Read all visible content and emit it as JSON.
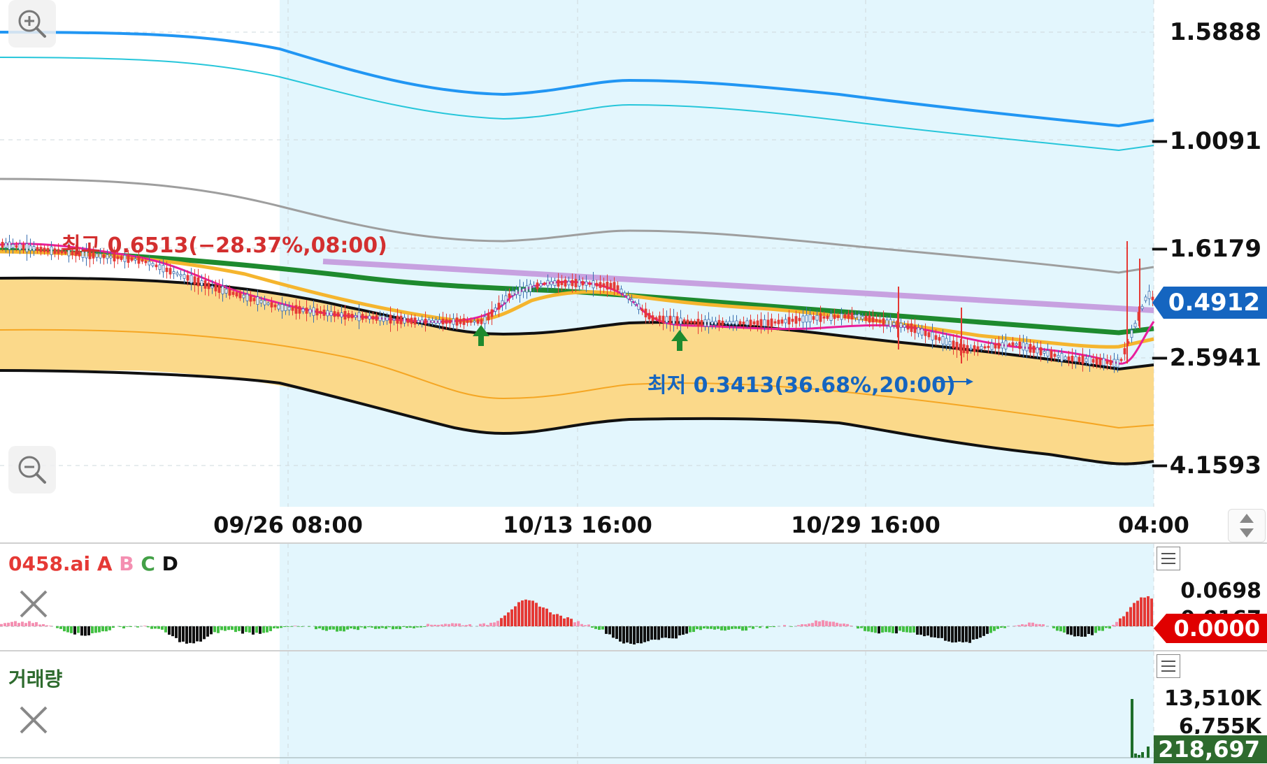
{
  "main_chart": {
    "price_labels": [
      "1.5888",
      "−1.0091",
      "−1.6179",
      "−2.5941",
      "−4.1593"
    ],
    "current_price": "0.4912",
    "current_price_color": "#1565c0",
    "high_annotation": "최고 0.6513(−28.37%,08:00)",
    "low_annotation": "최저 0.3413(36.68%,20:00)",
    "high_color": "#d32f2f",
    "low_color": "#1565c0",
    "zoom_in_icon": "zoom-in-icon",
    "zoom_out_icon": "zoom-out-icon"
  },
  "time_axis": {
    "labels": [
      "09/26 08:00",
      "10/13 16:00",
      "10/29 16:00",
      "04:00"
    ],
    "scroll_icon": "up-down-arrows-icon"
  },
  "indicator_pane": {
    "title_prefix": "0458.ai",
    "legend": [
      {
        "label": "A",
        "color": "#e53935"
      },
      {
        "label": "B",
        "color": "#f48fb1"
      },
      {
        "label": "C",
        "color": "#43a047"
      },
      {
        "label": "D",
        "color": "#111111"
      }
    ],
    "axis_labels": [
      "0.0698",
      "0.0167"
    ],
    "current_value": "0.0000",
    "current_value_color": "#e00000"
  },
  "volume_pane": {
    "title": "거래량",
    "axis_labels": [
      "13,510K",
      "6,755K"
    ],
    "current_value": "218,697",
    "current_value_color": "#2e6b2e"
  }
}
